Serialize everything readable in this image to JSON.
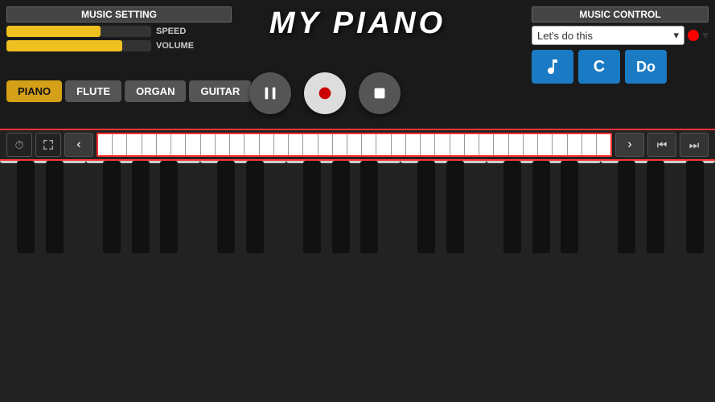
{
  "app": {
    "title": "MY PIANO"
  },
  "settings": {
    "label": "MUSIC SETTING",
    "speed": {
      "label": "SPEED",
      "value": 65
    },
    "volume": {
      "label": "VOLUME",
      "value": 80
    }
  },
  "instruments": [
    {
      "id": "piano",
      "label": "PIANO",
      "active": true
    },
    {
      "id": "flute",
      "label": "FLUTE",
      "active": false
    },
    {
      "id": "organ",
      "label": "ORGAN",
      "active": false
    },
    {
      "id": "guitar",
      "label": "GUITAR",
      "active": false
    }
  ],
  "controls": {
    "pause_label": "⏸",
    "record_label": "●",
    "stop_label": "■"
  },
  "music_control": {
    "label": "MUSIC CONTROL",
    "song": "Let's do this",
    "dropdown_arrow": "▾",
    "action_btns": [
      {
        "id": "note-btn",
        "label": "♪"
      },
      {
        "id": "c-btn",
        "label": "C"
      },
      {
        "id": "do-btn",
        "label": "Do"
      }
    ]
  },
  "nav": {
    "prev_label": "‹",
    "next_label": "›",
    "rewind_label": "«",
    "forward_label": "»",
    "timer_icon": "⏱",
    "fullscreen_icon": "⛶"
  },
  "colors": {
    "accent_red": "#ff3333",
    "accent_yellow": "#f0c020",
    "accent_blue": "#1a7bc4",
    "bg_dark": "#1a1a1a",
    "bg_piano": "#222"
  }
}
